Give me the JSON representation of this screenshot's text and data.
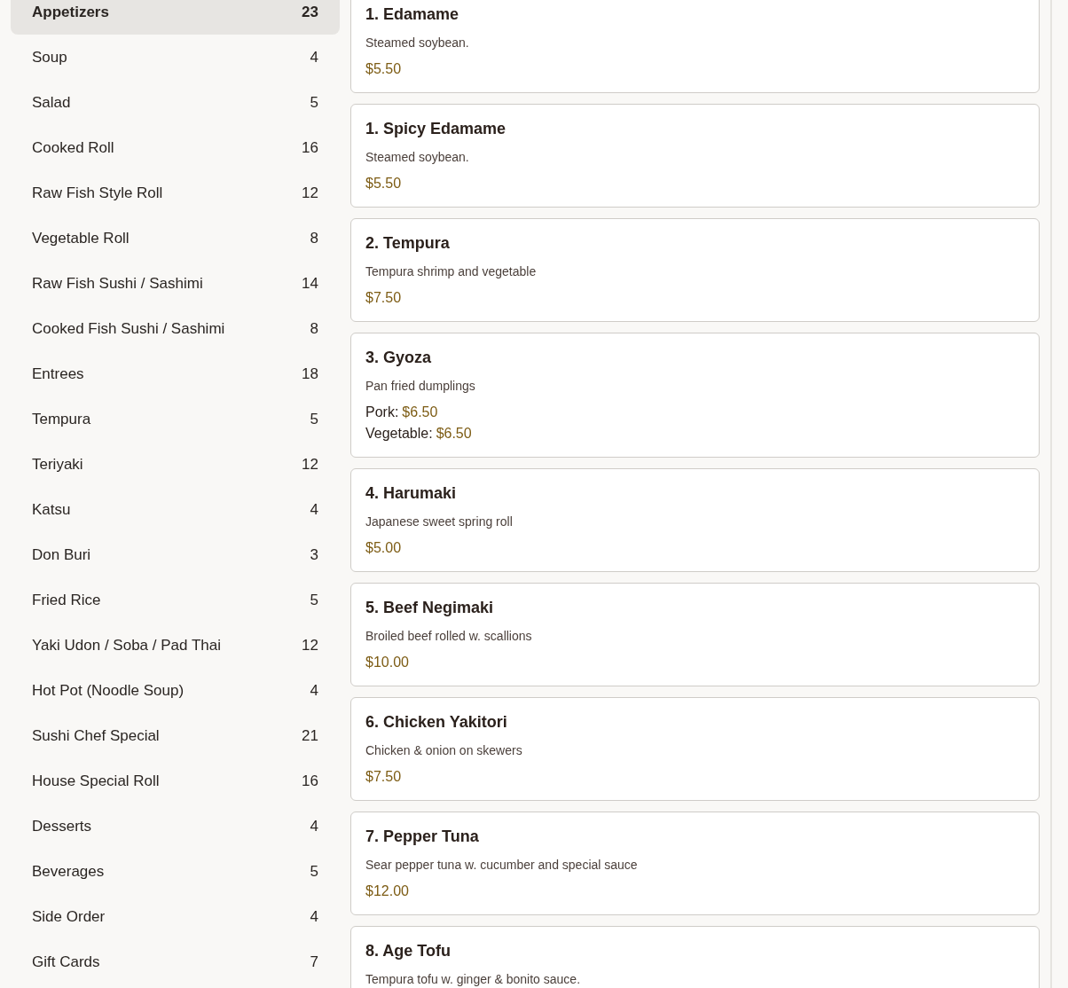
{
  "categories": [
    {
      "name": "Appetizers",
      "count": "23",
      "selected": true
    },
    {
      "name": "Soup",
      "count": "4",
      "selected": false
    },
    {
      "name": "Salad",
      "count": "5",
      "selected": false
    },
    {
      "name": "Cooked Roll",
      "count": "16",
      "selected": false
    },
    {
      "name": "Raw Fish Style Roll",
      "count": "12",
      "selected": false
    },
    {
      "name": "Vegetable Roll",
      "count": "8",
      "selected": false
    },
    {
      "name": "Raw Fish Sushi / Sashimi",
      "count": "14",
      "selected": false
    },
    {
      "name": "Cooked Fish Sushi / Sashimi",
      "count": "8",
      "selected": false
    },
    {
      "name": "Entrees",
      "count": "18",
      "selected": false
    },
    {
      "name": "Tempura",
      "count": "5",
      "selected": false
    },
    {
      "name": "Teriyaki",
      "count": "12",
      "selected": false
    },
    {
      "name": "Katsu",
      "count": "4",
      "selected": false
    },
    {
      "name": "Don Buri",
      "count": "3",
      "selected": false
    },
    {
      "name": "Fried Rice",
      "count": "5",
      "selected": false
    },
    {
      "name": "Yaki Udon / Soba / Pad Thai",
      "count": "12",
      "selected": false
    },
    {
      "name": "Hot Pot (Noodle Soup)",
      "count": "4",
      "selected": false
    },
    {
      "name": "Sushi Chef Special",
      "count": "21",
      "selected": false
    },
    {
      "name": "House Special Roll",
      "count": "16",
      "selected": false
    },
    {
      "name": "Desserts",
      "count": "4",
      "selected": false
    },
    {
      "name": "Beverages",
      "count": "5",
      "selected": false
    },
    {
      "name": "Side Order",
      "count": "4",
      "selected": false
    },
    {
      "name": "Gift Cards",
      "count": "7",
      "selected": false
    }
  ],
  "menu_items": [
    {
      "title": "1. Edamame",
      "description": "Steamed soybean.",
      "prices": [
        {
          "price": "$5.50"
        }
      ]
    },
    {
      "title": "1. Spicy Edamame",
      "description": "Steamed soybean.",
      "prices": [
        {
          "price": "$5.50"
        }
      ]
    },
    {
      "title": "2. Tempura",
      "description": "Tempura shrimp and vegetable",
      "prices": [
        {
          "price": "$7.50"
        }
      ]
    },
    {
      "title": "3. Gyoza",
      "description": "Pan fried dumplings",
      "prices": [
        {
          "label": "Pork:",
          "price": "$6.50"
        },
        {
          "label": "Vegetable:",
          "price": "$6.50"
        }
      ]
    },
    {
      "title": "4. Harumaki",
      "description": "Japanese sweet spring roll",
      "prices": [
        {
          "price": "$5.00"
        }
      ]
    },
    {
      "title": "5. Beef Negimaki",
      "description": "Broiled beef rolled w. scallions",
      "prices": [
        {
          "price": "$10.00"
        }
      ]
    },
    {
      "title": "6. Chicken Yakitori",
      "description": "Chicken & onion on skewers",
      "prices": [
        {
          "price": "$7.50"
        }
      ]
    },
    {
      "title": "7. Pepper Tuna",
      "description": "Sear pepper tuna w. cucumber and special sauce",
      "prices": [
        {
          "price": "$12.00"
        }
      ]
    },
    {
      "title": "8. Age Tofu",
      "description": "Tempura tofu w. ginger & bonito sauce."
    }
  ]
}
